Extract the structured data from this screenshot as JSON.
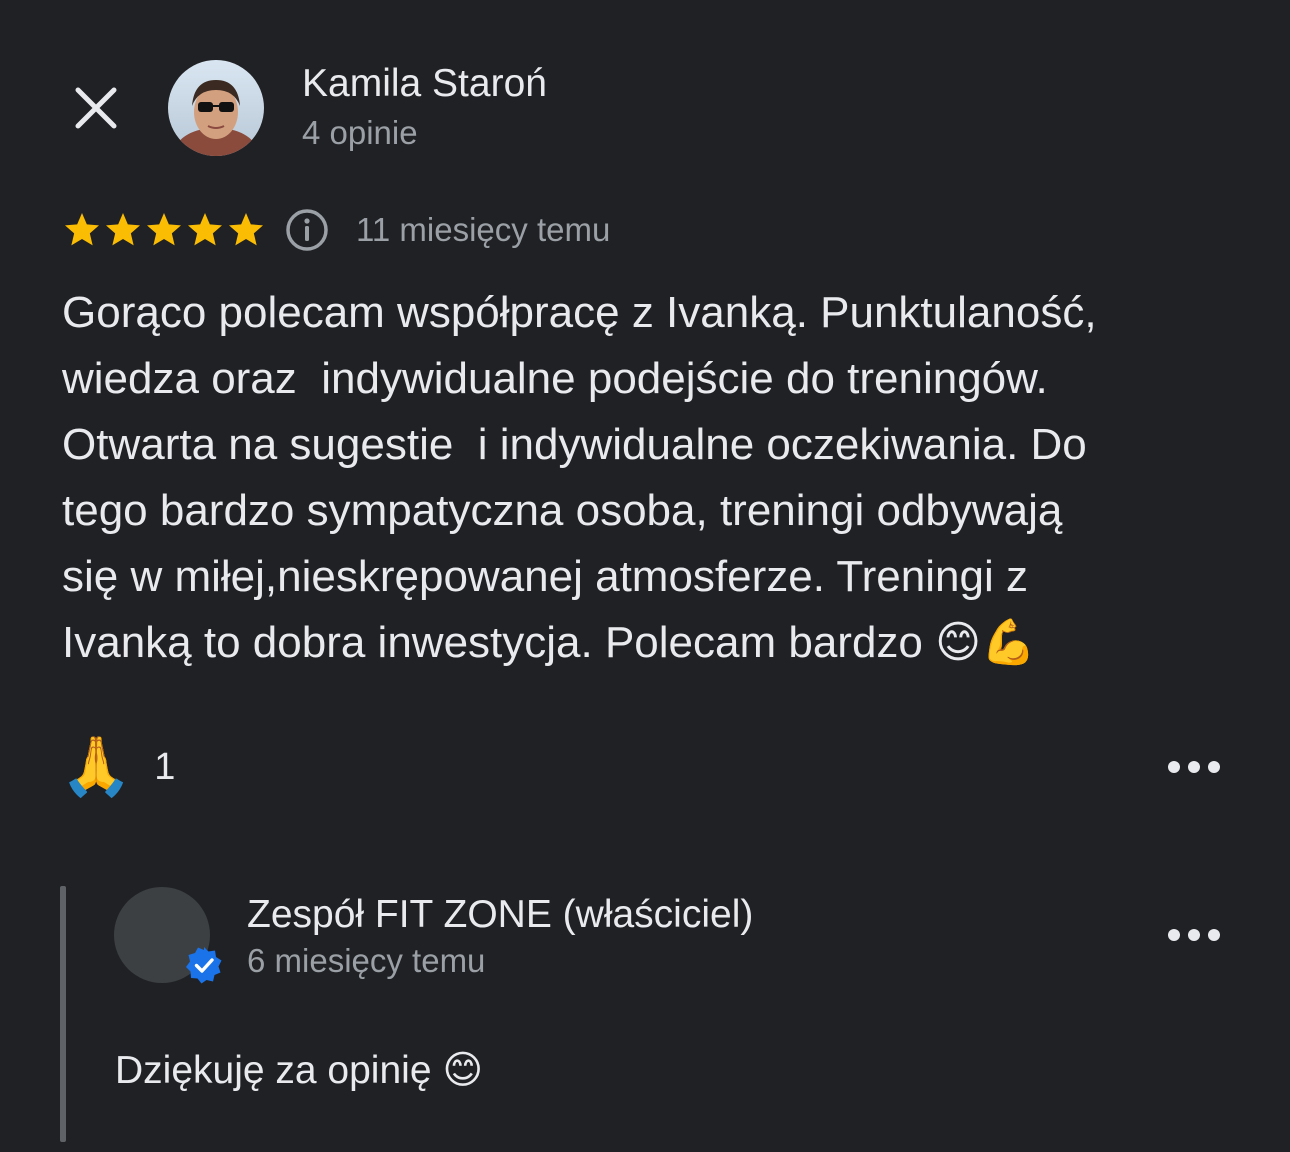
{
  "header": {
    "close_icon": "close-icon",
    "author_name": "Kamila Staroń",
    "author_meta": "4 opinie",
    "avatar": "profile-photo"
  },
  "review": {
    "rating": 5,
    "max_rating": 5,
    "star_color": "#fbbc04",
    "info_icon": "info-icon",
    "date": "11 miesięcy temu",
    "text": "Gorąco polecam współpracę z Ivanką. Punktulaność,\nwiedza oraz  indywidualne podejście do treningów.\nOtwarta na sugestie  i indywidualne oczekiwania. Do\ntego bardzo sympatyczna osoba, treningi odbywają\nsię w miłej,nieskrępowanej atmosferze. Treningi z\nIvanką to dobra inwestycja. Polecam bardzo 😊💪",
    "reaction_emoji": "🙏",
    "reaction_count": "1",
    "more_icon": "more-horizontal-icon"
  },
  "owner_reply": {
    "name": "Zespół FIT ZONE (właściciel)",
    "date": "6 miesięcy temu",
    "text": "Dziękuję za opinię 😊",
    "verified_color": "#1a73e8",
    "more_icon": "more-horizontal-icon"
  },
  "colors": {
    "background": "#202124",
    "primary_text": "#e8eaed",
    "secondary_text": "#9aa0a6"
  }
}
